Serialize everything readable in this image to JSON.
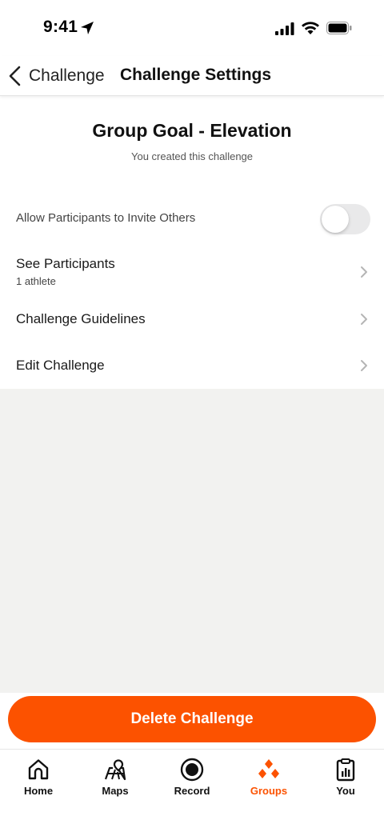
{
  "status_bar": {
    "time": "9:41"
  },
  "nav": {
    "back_label": "Challenge",
    "title": "Challenge Settings"
  },
  "header": {
    "title": "Group Goal - Elevation",
    "subtitle": "You created this challenge"
  },
  "settings": {
    "allow_invite": {
      "label": "Allow Participants to Invite Others",
      "enabled": false
    },
    "participants": {
      "label": "See Participants",
      "sub": "1 athlete"
    },
    "guidelines": {
      "label": "Challenge Guidelines"
    },
    "edit": {
      "label": "Edit Challenge"
    }
  },
  "delete_button": {
    "label": "Delete Challenge"
  },
  "tabs": [
    {
      "label": "Home",
      "icon": "home-icon",
      "active": false
    },
    {
      "label": "Maps",
      "icon": "map-icon",
      "active": false
    },
    {
      "label": "Record",
      "icon": "record-icon",
      "active": false
    },
    {
      "label": "Groups",
      "icon": "groups-icon",
      "active": true
    },
    {
      "label": "You",
      "icon": "clipboard-icon",
      "active": false
    }
  ],
  "colors": {
    "accent": "#fc5200",
    "background_gray": "#f2f2f0"
  }
}
